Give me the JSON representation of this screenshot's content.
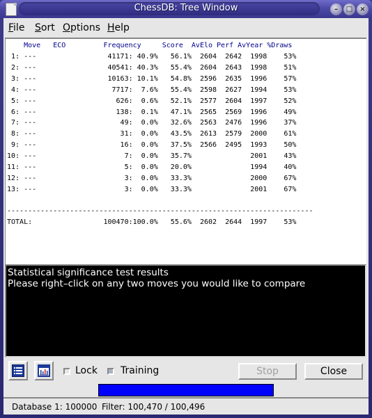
{
  "window": {
    "title": "ChessDB: Tree Window",
    "buttons": [
      "minimize",
      "maximize",
      "close"
    ]
  },
  "menu": [
    {
      "label_u": "F",
      "label_rest": "ile"
    },
    {
      "label_u": "S",
      "label_rest": "ort"
    },
    {
      "label_u": "O",
      "label_rest": "ptions"
    },
    {
      "label_u": "H",
      "label_rest": "elp"
    }
  ],
  "tree": {
    "columns": [
      "Move",
      "ECO",
      "Frequency",
      "Score",
      "AvElo",
      "Perf",
      "AvYear",
      "%Draws"
    ],
    "rows": [
      {
        "n": "1:",
        "move": "---",
        "eco": "",
        "count": "41171",
        "pct": "40.9%",
        "score": "56.1%",
        "avelo": "2604",
        "perf": "2642",
        "avyear": "1998",
        "draws": "53%"
      },
      {
        "n": "2:",
        "move": "---",
        "eco": "",
        "count": "40541",
        "pct": "40.3%",
        "score": "55.4%",
        "avelo": "2604",
        "perf": "2643",
        "avyear": "1998",
        "draws": "51%"
      },
      {
        "n": "3:",
        "move": "---",
        "eco": "",
        "count": "10163",
        "pct": "10.1%",
        "score": "54.8%",
        "avelo": "2596",
        "perf": "2635",
        "avyear": "1996",
        "draws": "57%"
      },
      {
        "n": "4:",
        "move": "---",
        "eco": "",
        "count": "7717",
        "pct": "7.6%",
        "score": "55.4%",
        "avelo": "2598",
        "perf": "2627",
        "avyear": "1994",
        "draws": "53%"
      },
      {
        "n": "5:",
        "move": "---",
        "eco": "",
        "count": "626",
        "pct": "0.6%",
        "score": "52.1%",
        "avelo": "2577",
        "perf": "2604",
        "avyear": "1997",
        "draws": "52%"
      },
      {
        "n": "6:",
        "move": "---",
        "eco": "",
        "count": "138",
        "pct": "0.1%",
        "score": "47.1%",
        "avelo": "2565",
        "perf": "2569",
        "avyear": "1996",
        "draws": "49%"
      },
      {
        "n": "7:",
        "move": "---",
        "eco": "",
        "count": "49",
        "pct": "0.0%",
        "score": "32.6%",
        "avelo": "2563",
        "perf": "2476",
        "avyear": "1996",
        "draws": "37%"
      },
      {
        "n": "8:",
        "move": "---",
        "eco": "",
        "count": "31",
        "pct": "0.0%",
        "score": "43.5%",
        "avelo": "2613",
        "perf": "2579",
        "avyear": "2000",
        "draws": "61%"
      },
      {
        "n": "9:",
        "move": "---",
        "eco": "",
        "count": "16",
        "pct": "0.0%",
        "score": "37.5%",
        "avelo": "2566",
        "perf": "2495",
        "avyear": "1993",
        "draws": "50%"
      },
      {
        "n": "10:",
        "move": "---",
        "eco": "",
        "count": "7",
        "pct": "0.0%",
        "score": "35.7%",
        "avelo": "",
        "perf": "",
        "avyear": "2001",
        "draws": "43%"
      },
      {
        "n": "11:",
        "move": "---",
        "eco": "",
        "count": "5",
        "pct": "0.0%",
        "score": "20.0%",
        "avelo": "",
        "perf": "",
        "avyear": "1994",
        "draws": "40%"
      },
      {
        "n": "12:",
        "move": "---",
        "eco": "",
        "count": "3",
        "pct": "0.0%",
        "score": "33.3%",
        "avelo": "",
        "perf": "",
        "avyear": "2000",
        "draws": "67%"
      },
      {
        "n": "13:",
        "move": "---",
        "eco": "",
        "count": "3",
        "pct": "0.0%",
        "score": "33.3%",
        "avelo": "",
        "perf": "",
        "avyear": "2001",
        "draws": "67%"
      }
    ],
    "total": {
      "label": "TOTAL:",
      "count": "100470",
      "pct": "100.0%",
      "score": "55.6%",
      "avelo": "2602",
      "perf": "2644",
      "avyear": "1997",
      "draws": "53%"
    }
  },
  "stats_panel": {
    "line1": "Statistical significance test results",
    "line2": "Please right–click on any two moves you would like to compare"
  },
  "controls": {
    "lock_label": "Lock",
    "lock_checked": false,
    "training_label": "Training",
    "training_checked": false,
    "stop_label": "Stop",
    "close_label": "Close",
    "progress_fraction": 1.0,
    "progress_color": "#0000ff"
  },
  "status": {
    "database": "Database 1: 100000",
    "filter": "Filter: 100,470 / 100,496"
  }
}
